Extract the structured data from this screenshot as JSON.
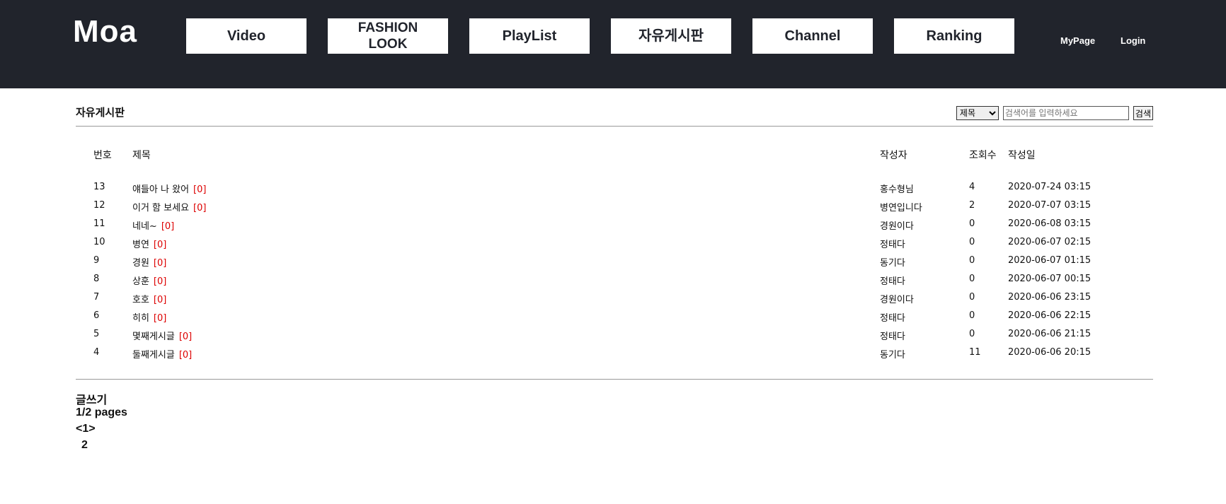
{
  "header": {
    "logo": "Moa",
    "nav": [
      {
        "label": "Video"
      },
      {
        "label": "FASHION LOOK",
        "line1": "FASHION",
        "line2": "LOOK"
      },
      {
        "label": "PlayList"
      },
      {
        "label": "자유게시판"
      },
      {
        "label": "Channel"
      },
      {
        "label": "Ranking"
      }
    ],
    "mypage": "MyPage",
    "login": "Login"
  },
  "board": {
    "title": "자유게시판",
    "search": {
      "select_value": "제목",
      "placeholder": "검색어를 입력하세요",
      "button": "검색"
    },
    "columns": {
      "no": "번호",
      "title": "제목",
      "writer": "작성자",
      "views": "조회수",
      "date": "작성일"
    },
    "rows": [
      {
        "no": "13",
        "title": "얘들아 나 왔어",
        "comments": "[0]",
        "writer": "홍수형님",
        "views": "4",
        "date": "2020-07-24 03:15"
      },
      {
        "no": "12",
        "title": "이거 함 보세요",
        "comments": "[0]",
        "writer": "병연입니다",
        "views": "2",
        "date": "2020-07-07 03:15"
      },
      {
        "no": "11",
        "title": "네네~",
        "comments": "[0]",
        "writer": "경원이다",
        "views": "0",
        "date": "2020-06-08 03:15"
      },
      {
        "no": "10",
        "title": "병연",
        "comments": "[0]",
        "writer": "정태다",
        "views": "0",
        "date": "2020-06-07 02:15"
      },
      {
        "no": "9",
        "title": "경원",
        "comments": "[0]",
        "writer": "동기다",
        "views": "0",
        "date": "2020-06-07 01:15"
      },
      {
        "no": "8",
        "title": "상훈",
        "comments": "[0]",
        "writer": "정태다",
        "views": "0",
        "date": "2020-06-07 00:15"
      },
      {
        "no": "7",
        "title": "호호",
        "comments": "[0]",
        "writer": "경원이다",
        "views": "0",
        "date": "2020-06-06 23:15"
      },
      {
        "no": "6",
        "title": "히히",
        "comments": "[0]",
        "writer": "정태다",
        "views": "0",
        "date": "2020-06-06 22:15"
      },
      {
        "no": "5",
        "title": "몇째게시글",
        "comments": "[0]",
        "writer": "정태다",
        "views": "0",
        "date": "2020-06-06 21:15"
      },
      {
        "no": "4",
        "title": "둘째게시글",
        "comments": "[0]",
        "writer": "동기다",
        "views": "11",
        "date": "2020-06-06 20:15"
      }
    ]
  },
  "footer": {
    "write": "글쓰기",
    "pages": "1/2 pages",
    "current": "<1>",
    "next": "2"
  }
}
